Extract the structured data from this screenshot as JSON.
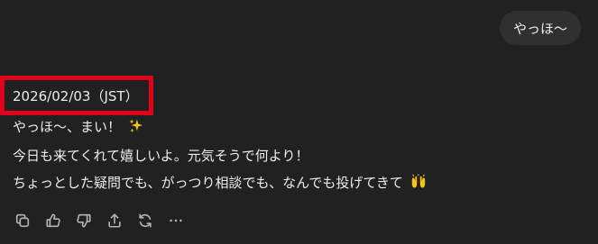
{
  "user_message": {
    "text": "やっほ〜"
  },
  "assistant_message": {
    "timestamp": "2026/02/03（JST）",
    "line1": "やっほ〜、まい！",
    "line2": "今日も来てくれて嬉しいよ。元気そうで何より！",
    "line3": "ちょっとした疑問でも、がっつり相談でも、なんでも投げてきて",
    "emojis": [
      "sparkles-icon",
      "raised-hands-icon"
    ]
  },
  "actions": [
    "copy-icon",
    "thumbs-up-icon",
    "thumbs-down-icon",
    "share-icon",
    "regenerate-icon",
    "more-icon"
  ],
  "colors": {
    "background": "#212121",
    "bubble": "#303030",
    "text": "#ececec",
    "icon": "#b4b4b4",
    "highlight": "#e3001b"
  }
}
